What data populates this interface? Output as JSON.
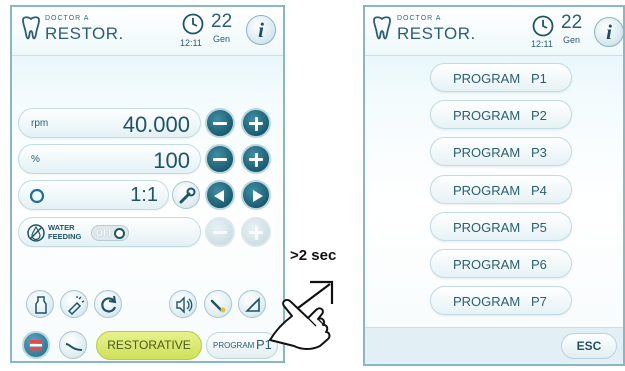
{
  "left": {
    "header": {
      "brand_small": "DOCTOR A",
      "brand_big": "RESTOR.",
      "time": "12:11",
      "day": "22",
      "month": "Gen",
      "info_glyph": "i"
    },
    "rows": [
      {
        "label": "rpm",
        "value": "40.000"
      },
      {
        "label": "%",
        "value": "100"
      },
      {
        "label": "",
        "value": "1:1"
      }
    ],
    "water": {
      "label_line1": "WATER",
      "label_line2": "FEEDING",
      "toggle_state": "OFF"
    },
    "bottom": {
      "mode_label": "RESTORATIVE",
      "program_label": "PROGRAM",
      "program_value": "P1"
    }
  },
  "right": {
    "header": {
      "brand_small": "DOCTOR A",
      "brand_big": "RESTOR.",
      "time": "12:11",
      "day": "22",
      "month": "Gen",
      "info_glyph": "i"
    },
    "programs": [
      {
        "label": "PROGRAM",
        "value": "P1"
      },
      {
        "label": "PROGRAM",
        "value": "P2"
      },
      {
        "label": "PROGRAM",
        "value": "P3"
      },
      {
        "label": "PROGRAM",
        "value": "P4"
      },
      {
        "label": "PROGRAM",
        "value": "P5"
      },
      {
        "label": "PROGRAM",
        "value": "P6"
      },
      {
        "label": "PROGRAM",
        "value": "P7"
      }
    ],
    "esc_label": "ESC"
  },
  "annotation": ">2 sec",
  "colors": {
    "accent": "#1b5c70",
    "highlight": "#d5e85a",
    "frame": "#8ab7c6"
  }
}
